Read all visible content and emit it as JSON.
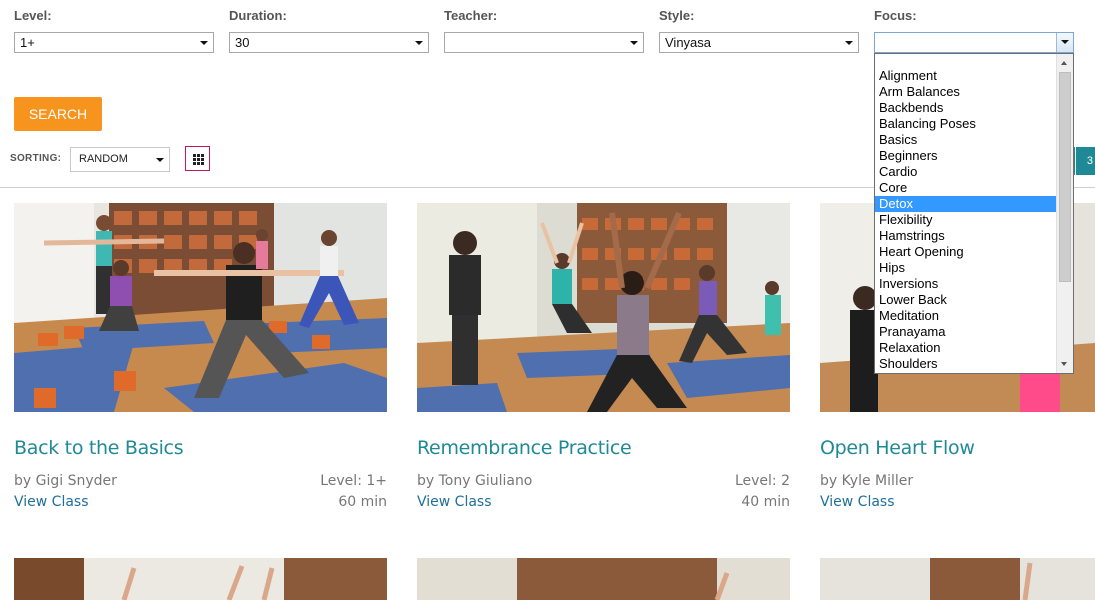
{
  "filters": {
    "level": {
      "label": "Level:",
      "value": "1+"
    },
    "duration": {
      "label": "Duration:",
      "value": "30"
    },
    "teacher": {
      "label": "Teacher:",
      "value": ""
    },
    "style": {
      "label": "Style:",
      "value": "Vinyasa"
    },
    "focus": {
      "label": "Focus:",
      "value": "",
      "options": [
        "Alignment",
        "Arm Balances",
        "Backbends",
        "Balancing Poses",
        "Basics",
        "Beginners",
        "Cardio",
        "Core",
        "Detox",
        "Flexibility",
        "Hamstrings",
        "Heart Opening",
        "Hips",
        "Inversions",
        "Lower Back",
        "Meditation",
        "Pranayama",
        "Relaxation",
        "Shoulders"
      ],
      "highlighted": "Detox"
    }
  },
  "search": {
    "label": "SEARCH"
  },
  "sorting": {
    "label": "SORTING:",
    "value": "RANDOM"
  },
  "pager": {
    "current": "3"
  },
  "colors": {
    "accent": "#1f8a96",
    "search": "#f7941d",
    "link": "#1f6f9a",
    "highlight": "#3399ff",
    "grid_border": "#c2185b"
  },
  "classes": [
    {
      "title": "Back to the Basics",
      "teacher": "by Gigi Snyder",
      "level": "Level: 1+",
      "duration": "60 min",
      "link": "View Class"
    },
    {
      "title": "Remembrance Practice",
      "teacher": "by Tony Giuliano",
      "level": "Level: 2",
      "duration": "40 min",
      "link": "View Class"
    },
    {
      "title": "Open Heart Flow",
      "teacher": "by Kyle Miller",
      "level": "",
      "duration": "",
      "link": "View Class"
    }
  ]
}
